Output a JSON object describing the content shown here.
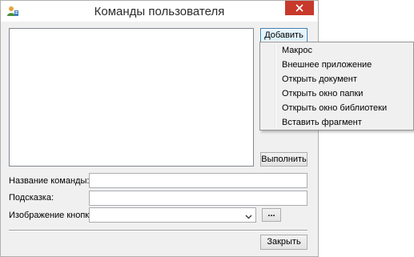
{
  "window": {
    "title": "Команды пользователя",
    "app_icon": "user-icon",
    "close_icon": "close-icon"
  },
  "commands_list": {
    "items": []
  },
  "buttons": {
    "add_prefix": "Д",
    "add_rest": "обавить",
    "run": "Выполнить",
    "close": "Закрыть",
    "browse": "..."
  },
  "add_menu": {
    "items": [
      "Макрос",
      "Внешнее приложение",
      "Открыть документ",
      "Открыть окно папки",
      "Открыть окно библиотеки",
      "Вставить фрагмент"
    ]
  },
  "form": {
    "command_name_label": "Название команды:",
    "command_name_value": "",
    "hint_label": "Подсказка:",
    "hint_value": "",
    "button_image_label": "Изображение кнопки:",
    "button_image_value": ""
  },
  "colors": {
    "close_button": "#c7392b",
    "focus_border": "#3c7fb1"
  }
}
